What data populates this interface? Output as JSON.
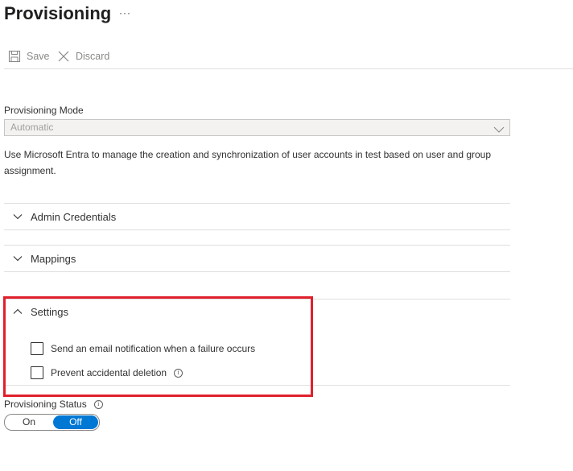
{
  "page": {
    "title": "Provisioning",
    "more_label": "···"
  },
  "toolbar": {
    "save_label": "Save",
    "discard_label": "Discard"
  },
  "provisioning_mode": {
    "label": "Provisioning Mode",
    "selected": "Automatic",
    "description": "Use Microsoft Entra to manage the creation and synchronization of user accounts in test based on user and group assignment."
  },
  "sections": {
    "admin_credentials": {
      "title": "Admin Credentials",
      "expanded": false
    },
    "mappings": {
      "title": "Mappings",
      "expanded": false
    },
    "settings": {
      "title": "Settings",
      "expanded": true,
      "options": [
        {
          "label": "Send an email notification when a failure occurs",
          "checked": false
        },
        {
          "label": "Prevent accidental deletion",
          "checked": false,
          "info": true
        }
      ]
    }
  },
  "provisioning_status": {
    "label": "Provisioning Status",
    "on_label": "On",
    "off_label": "Off",
    "value": "Off"
  },
  "colors": {
    "accent": "#0078d4",
    "highlight": "#e0202d",
    "divider": "#e1dfdd",
    "disabled_text": "#8a8886"
  },
  "icons": {
    "save": "save-icon",
    "discard": "close-icon",
    "dropdown": "chevron-down-icon",
    "collapsed_section": "chevron-down-icon",
    "expanded_section": "chevron-up-icon",
    "info": "info-icon"
  }
}
